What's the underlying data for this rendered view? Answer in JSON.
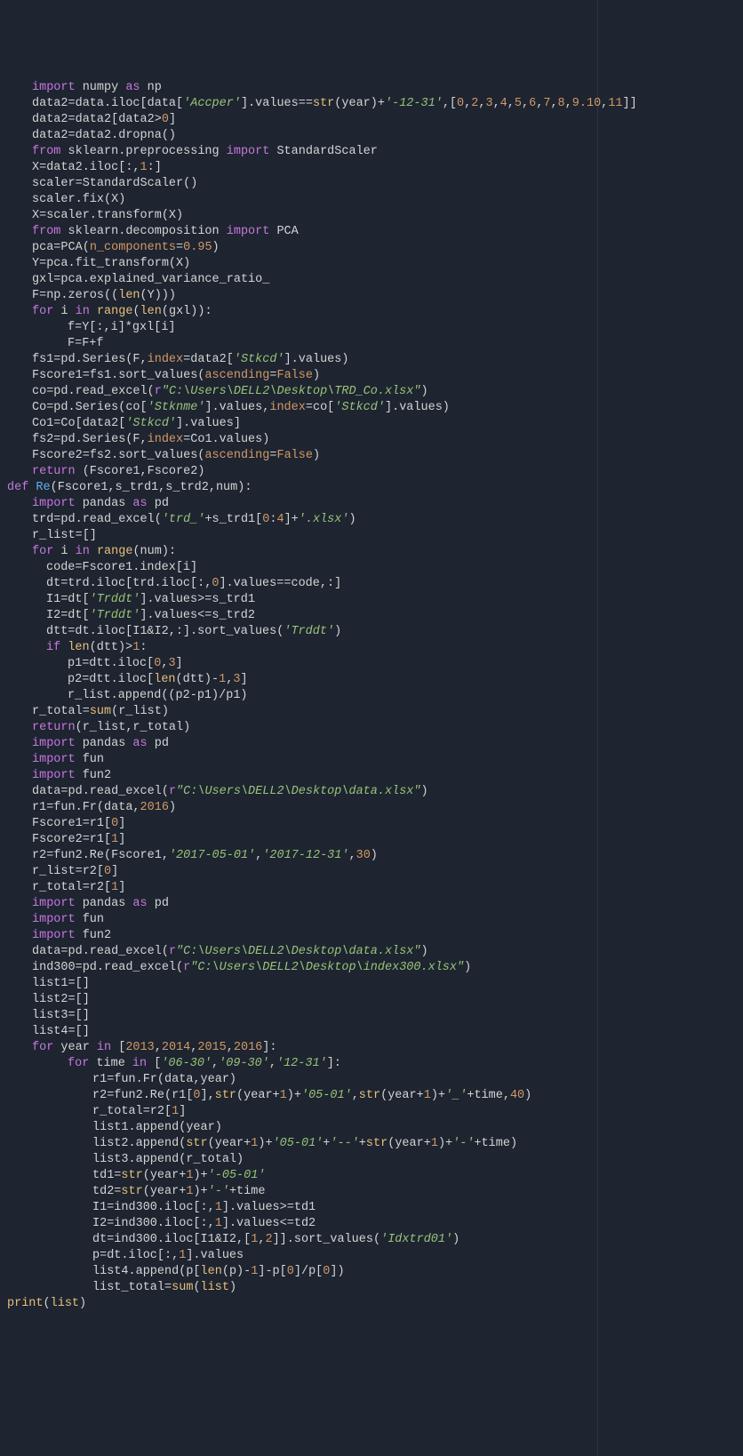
{
  "lines": [
    {
      "indent": "i1",
      "html": "<span class='kw'>import</span> numpy <span class='kw'>as</span> np"
    },
    {
      "indent": "i1",
      "html": "data2=data.iloc[data[<span class='str'>'Accper'</span>].values==<span class='builtin'>str</span>(year)+<span class='str'>'-12-31'</span>,[<span class='num'>0</span>,<span class='num'>2</span>,<span class='num'>3</span>,<span class='num'>4</span>,<span class='num'>5</span>,<span class='num'>6</span>,<span class='num'>7</span>,<span class='num'>8</span>,<span class='num'>9.10</span>,<span class='num'>11</span>]]"
    },
    {
      "indent": "i1",
      "html": "data2=data2[data2&gt;<span class='num'>0</span>]"
    },
    {
      "indent": "i1",
      "html": "data2=data2.dropna()"
    },
    {
      "indent": "i1",
      "html": "<span class='kw'>from</span> sklearn.preprocessing <span class='kw'>import</span> StandardScaler"
    },
    {
      "indent": "i1",
      "html": "X=data2.iloc[:,<span class='num'>1</span>:]"
    },
    {
      "indent": "i1",
      "html": "scaler=StandardScaler()"
    },
    {
      "indent": "i1",
      "html": "scaler.fix(X)"
    },
    {
      "indent": "i1",
      "html": "X=scaler.transform(X)"
    },
    {
      "indent": "i1",
      "html": "<span class='kw'>from</span> sklearn.decomposition <span class='kw'>import</span> PCA"
    },
    {
      "indent": "i1",
      "html": "pca=PCA(<span class='param'>n_components</span>=<span class='num'>0.95</span>)"
    },
    {
      "indent": "i1",
      "html": "Y=pca.fit_transform(X)"
    },
    {
      "indent": "i1",
      "html": "gxl=pca.explained_variance_ratio_"
    },
    {
      "indent": "i1",
      "html": "F=np.zeros((<span class='builtin'>len</span>(Y)))"
    },
    {
      "indent": "i1",
      "html": "<span class='kw'>for</span> i <span class='kw'>in</span> <span class='builtin'>range</span>(<span class='builtin'>len</span>(gxl)):"
    },
    {
      "indent": "i3",
      "html": "f=Y[:,i]*gxl[i]"
    },
    {
      "indent": "i3",
      "html": "F=F+f"
    },
    {
      "indent": "i1",
      "html": "fs1=pd.Series(F,<span class='param'>index</span>=data2[<span class='str'>'Stkcd'</span>].values)"
    },
    {
      "indent": "i1",
      "html": "Fscore1=fs1.sort_values(<span class='param'>ascending</span>=<span class='bool'>False</span>)"
    },
    {
      "indent": "i1",
      "html": "co=pd.read_excel(<span class='kw'>r</span><span class='str'>\"C:\\Users\\DELL2\\Desktop\\TRD_Co.xlsx\"</span>)"
    },
    {
      "indent": "i1",
      "html": "Co=pd.Series(co[<span class='str'>'Stknme'</span>].values,<span class='param'>index</span>=co[<span class='str'>'Stkcd'</span>].values)"
    },
    {
      "indent": "i1",
      "html": "Co1=Co[data2[<span class='str'>'Stkcd'</span>].values]"
    },
    {
      "indent": "i1",
      "html": "fs2=pd.Series(F,<span class='param'>index</span>=Co1.values)"
    },
    {
      "indent": "i1",
      "html": "Fscore2=fs2.sort_values(<span class='param'>ascending</span>=<span class='bool'>False</span>)"
    },
    {
      "indent": "i1",
      "html": "<span class='kw'>return</span> (Fscore1,Fscore2)"
    },
    {
      "indent": "",
      "html": "<span class='def'>def</span> <span class='defname'>Re</span>(Fscore1,s_trd1,s_trd2,num):"
    },
    {
      "indent": "i1",
      "html": "<span class='kw'>import</span> pandas <span class='kw'>as</span> pd"
    },
    {
      "indent": "i1",
      "html": "trd=pd.read_excel(<span class='str'>'trd_'</span>+s_trd1[<span class='num'>0</span>:<span class='num'>4</span>]+<span class='str'>'.xlsx'</span>)"
    },
    {
      "indent": "i1",
      "html": "r_list=[]"
    },
    {
      "indent": "i1",
      "html": "<span class='kw'>for</span> i <span class='kw'>in</span> <span class='builtin'>range</span>(num):"
    },
    {
      "indent": "i2",
      "html": "code=Fscore1.index[i]"
    },
    {
      "indent": "i2",
      "html": "dt=trd.iloc[trd.iloc[:,<span class='num'>0</span>].values==code,:]"
    },
    {
      "indent": "i2",
      "html": "I1=dt[<span class='str'>'Trddt'</span>].values&gt;=s_trd1"
    },
    {
      "indent": "i2",
      "html": "I2=dt[<span class='str'>'Trddt'</span>].values&lt;=s_trd2"
    },
    {
      "indent": "i2",
      "html": "dtt=dt.iloc[I1&amp;I2,:].sort_values(<span class='str'>'Trddt'</span>)"
    },
    {
      "indent": "i2",
      "html": "<span class='kw'>if</span> <span class='builtin'>len</span>(dtt)&gt;<span class='num'>1</span>:"
    },
    {
      "indent": "i3",
      "html": "p1=dtt.iloc[<span class='num'>0</span>,<span class='num'>3</span>]"
    },
    {
      "indent": "i3",
      "html": "p2=dtt.iloc[<span class='builtin'>len</span>(dtt)-<span class='num'>1</span>,<span class='num'>3</span>]"
    },
    {
      "indent": "i3",
      "html": "r_list.append((p2-p1)/p1)"
    },
    {
      "indent": "i1",
      "html": "r_total=<span class='builtin'>sum</span>(r_list)"
    },
    {
      "indent": "i1",
      "html": "<span class='kw'>return</span>(r_list,r_total)"
    },
    {
      "indent": "i1",
      "html": "<span class='kw'>import</span> pandas <span class='kw'>as</span> pd"
    },
    {
      "indent": "i1",
      "html": "<span class='kw'>import</span> fun"
    },
    {
      "indent": "i1",
      "html": "<span class='kw'>import</span> fun2"
    },
    {
      "indent": "i1",
      "html": "data=pd.read_excel(<span class='kw'>r</span><span class='str'>\"C:\\Users\\DELL2\\Desktop\\data.xlsx\"</span>)"
    },
    {
      "indent": "i1",
      "html": "r1=fun.Fr(data,<span class='num'>2016</span>)"
    },
    {
      "indent": "i1",
      "html": "Fscore1=r1[<span class='num'>0</span>]"
    },
    {
      "indent": "i1",
      "html": "Fscore2=r1[<span class='num'>1</span>]"
    },
    {
      "indent": "i1",
      "html": "r2=fun2.Re(Fscore1,<span class='str'>'2017-05-01'</span>,<span class='str'>'2017-12-31'</span>,<span class='num'>30</span>)"
    },
    {
      "indent": "i1",
      "html": "r_list=r2[<span class='num'>0</span>]"
    },
    {
      "indent": "i1",
      "html": "r_total=r2[<span class='num'>1</span>]"
    },
    {
      "indent": "i1",
      "html": "<span class='kw'>import</span> pandas <span class='kw'>as</span> pd"
    },
    {
      "indent": "i1",
      "html": "<span class='kw'>import</span> fun"
    },
    {
      "indent": "i1",
      "html": "<span class='kw'>import</span> fun2"
    },
    {
      "indent": "i1",
      "html": "data=pd.read_excel(<span class='kw'>r</span><span class='str'>\"C:\\Users\\DELL2\\Desktop\\data.xlsx\"</span>)"
    },
    {
      "indent": "i1",
      "html": "ind300=pd.read_excel(<span class='kw'>r</span><span class='str'>\"C:\\Users\\DELL2\\Desktop\\index300.xlsx\"</span>)"
    },
    {
      "indent": "i1",
      "html": "list1=[]"
    },
    {
      "indent": "i1",
      "html": "list2=[]"
    },
    {
      "indent": "i1",
      "html": "list3=[]"
    },
    {
      "indent": "i1",
      "html": "list4=[]"
    },
    {
      "indent": "i1",
      "html": "<span class='kw'>for</span> year <span class='kw'>in</span> [<span class='num'>2013</span>,<span class='num'>2014</span>,<span class='num'>2015</span>,<span class='num'>2016</span>]:"
    },
    {
      "indent": "i3",
      "html": "<span class='kw'>for</span> time <span class='kw'>in</span> [<span class='str'>'06-30'</span>,<span class='str'>'09-30'</span>,<span class='str'>'12-31'</span>]:"
    },
    {
      "indent": "i4",
      "html": "r1=fun.Fr(data,year)"
    },
    {
      "indent": "i4",
      "html": "r2=fun2.Re(r1[<span class='num'>0</span>],<span class='builtin'>str</span>(year+<span class='num'>1</span>)+<span class='str'>'05-01'</span>,<span class='builtin'>str</span>(year+<span class='num'>1</span>)+<span class='str'>'_'</span>+time,<span class='num'>40</span>)"
    },
    {
      "indent": "i4",
      "html": "r_total=r2[<span class='num'>1</span>]"
    },
    {
      "indent": "i4",
      "html": "list1.append(year)"
    },
    {
      "indent": "i4",
      "html": "list2.append(<span class='builtin'>str</span>(year+<span class='num'>1</span>)+<span class='str'>'05-01'</span>+<span class='str'>'--'</span>+<span class='builtin'>str</span>(year+<span class='num'>1</span>)+<span class='str'>'-'</span>+time)"
    },
    {
      "indent": "i4",
      "html": "list3.append(r_total)"
    },
    {
      "indent": "i4",
      "html": "td1=<span class='builtin'>str</span>(year+<span class='num'>1</span>)+<span class='str'>'-05-01'</span>"
    },
    {
      "indent": "i4",
      "html": "td2=<span class='builtin'>str</span>(year+<span class='num'>1</span>)+<span class='str'>'-'</span>+time"
    },
    {
      "indent": "i4",
      "html": "I1=ind300.iloc[:,<span class='num'>1</span>].values&gt;=td1"
    },
    {
      "indent": "i4",
      "html": "I2=ind300.iloc[:,<span class='num'>1</span>].values&lt;=td2"
    },
    {
      "indent": "i4",
      "html": "dt=ind300.iloc[I1&amp;I2,[<span class='num'>1</span>,<span class='num'>2</span>]].sort_values(<span class='str'>'Idxtrd01'</span>)"
    },
    {
      "indent": "i4",
      "html": "p=dt.iloc[:,<span class='num'>1</span>].values"
    },
    {
      "indent": "i4",
      "html": "list4.append(p[<span class='builtin'>len</span>(p)-<span class='num'>1</span>]-p[<span class='num'>0</span>]/p[<span class='num'>0</span>])"
    },
    {
      "indent": "i4",
      "html": "list_total=<span class='builtin'>sum</span>(<span class='builtin'>list</span>)"
    },
    {
      "indent": "",
      "html": "<span class='builtin'>print</span>(<span class='builtin'>list</span>)"
    }
  ]
}
